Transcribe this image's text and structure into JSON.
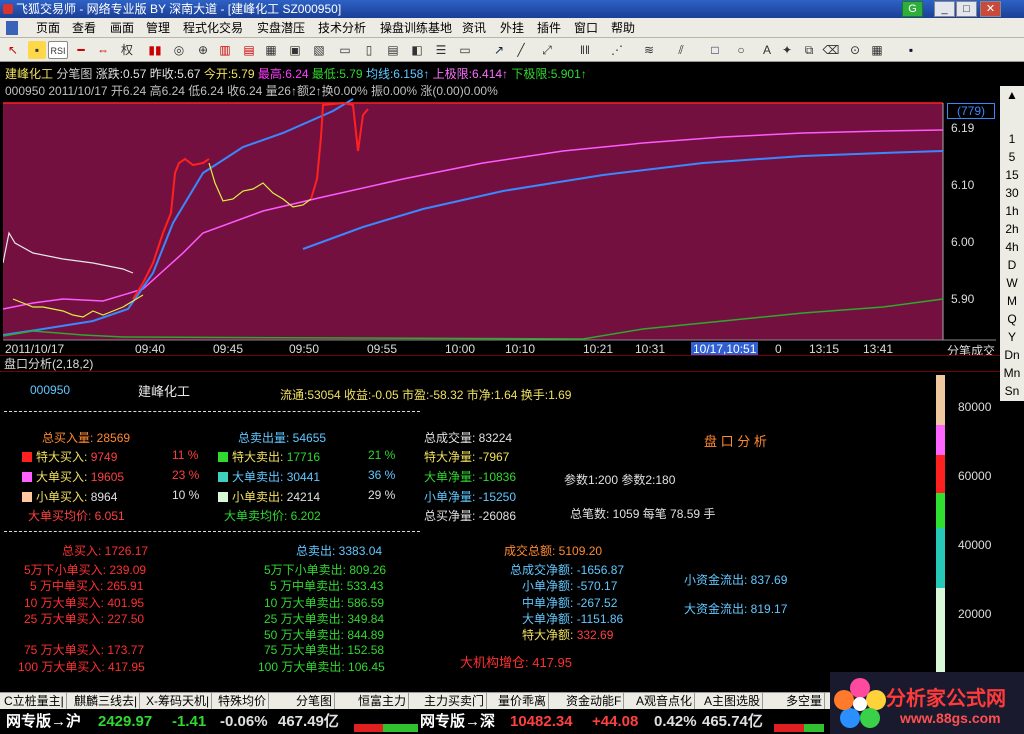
{
  "window": {
    "title": "飞狐交易师 - 网络专业版 BY 深南大道 - [建峰化工 SZ000950]",
    "min": "_",
    "max": "□",
    "close": "✕"
  },
  "menu": [
    "页面",
    "查看",
    "画面",
    "管理",
    "程式化交易",
    "实盘潜压",
    "技术分析",
    "操盘训练基地",
    "资讯",
    "外挂",
    "插件",
    "窗口",
    "帮助"
  ],
  "toolbar": {
    "rsi_label": "RSI",
    "quan_label": "权"
  },
  "chart": {
    "line1": {
      "name": "建峰化工",
      "type": "分笔图",
      "change": "涨跌:0.57",
      "prev": "昨收:5.67",
      "open": "今开:5.79",
      "high": "最高:6.24",
      "low": "最低:5.79",
      "avg": "均线:6.158↑",
      "uplimit": "上极限:6.414↑",
      "downlimit": "下极限:5.901↑"
    },
    "line2": "000950 2011/10/17 开6.24 高6.24 低6.24 收6.24 量26↑额2↑换0.00% 振0.00% 涨(0.00)0.00%",
    "price_box": "(779)",
    "y_labels": [
      "6.19",
      "6.10",
      "6.00",
      "5.90"
    ],
    "x_labels": [
      "2011/10/17",
      "09:40",
      "09:45",
      "09:50",
      "09:55",
      "10:00",
      "10:10",
      "10:21",
      "10:31",
      "10/17,10:51",
      "0",
      "13:15",
      "13:41"
    ],
    "corner_label": "分笔成交"
  },
  "sidebar": [
    "1",
    "5",
    "15",
    "30",
    "1h",
    "2h",
    "4h",
    "D",
    "W",
    "M",
    "Q",
    "Y",
    "Dn",
    "Mn",
    "Sn"
  ],
  "panel": {
    "title": "盘口分析(2,18,2)",
    "code": "000950",
    "name": "建峰化工",
    "stats": "流通:53054  收益:-0.05  市盈:-58.32  市净:1.64  换手:1.69",
    "buy_total": "总买入量: 28569",
    "buy_rows": [
      [
        "特大买入:",
        "9749",
        "11 %"
      ],
      [
        "大单买入:",
        "19605",
        "23 %"
      ],
      [
        "小单买入:",
        "8964",
        "10 %"
      ]
    ],
    "buy_avg": "大单买均价: 6.051",
    "sell_total": "总卖出量: 54655",
    "sell_rows": [
      [
        "特大卖出:",
        "17716",
        "21 %"
      ],
      [
        "大单卖出:",
        "30441",
        "36 %"
      ],
      [
        "小单卖出:",
        "24214",
        "29 %"
      ]
    ],
    "sell_avg": "大单卖均价: 6.202",
    "vol_rows": [
      "总成交量: 83224",
      "特大净量: -7967",
      "大单净量: -10836",
      "小单净量: -15250",
      "总买净量: -26086"
    ],
    "analysis_title": "盘 口 分 析",
    "params": "参数1:200  参数2:180",
    "total_trades": "总笔数: 1059  每笔  78.59 手",
    "total_buy": "总买入: 1726.17",
    "buy_amounts": [
      [
        "5万下小单买入:",
        "239.09"
      ],
      [
        "5 万中单买入:",
        "265.91"
      ],
      [
        "10 万大单买入:",
        "401.95"
      ],
      [
        "25 万大单买入:",
        "227.50"
      ],
      [
        "75 万大单买入:",
        "173.77"
      ],
      [
        "100 万大单买入:",
        "417.95"
      ]
    ],
    "total_sell": "总卖出: 3383.04",
    "sell_amounts": [
      [
        "5万下小单卖出:",
        "809.26"
      ],
      [
        "5 万中单卖出:",
        "533.43"
      ],
      [
        "10 万大单卖出:",
        "586.59"
      ],
      [
        "25 万大单卖出:",
        "349.84"
      ],
      [
        "50 万大单卖出:",
        "844.89"
      ],
      [
        "75 万大单卖出:",
        "152.58"
      ],
      [
        "100 万大单卖出:",
        "106.45"
      ]
    ],
    "turnover": "成交总额: 5109.20",
    "net_rows": [
      [
        "总成交净额:",
        "-1656.87"
      ],
      [
        "小单净额:",
        "-570.17"
      ],
      [
        "中单净额:",
        "-267.52"
      ],
      [
        "大单净额:",
        "-1151.86"
      ],
      [
        "特大净额:",
        "332.69"
      ]
    ],
    "small_out": "小资金流出: 837.69",
    "big_out": "大资金流出: 819.17",
    "inst": "大机构增仓: 417.95",
    "scale": [
      "80000",
      "60000",
      "40000",
      "20000"
    ]
  },
  "bottom_tabs": [
    "C立桩量主|",
    "麒麟三线去|",
    "X-筹码天机|",
    "特殊均价",
    "分笔图",
    "恒富主力",
    "主力买卖门",
    "量价乖离",
    "资金动能F",
    "A观音点化",
    "A主图选股",
    "多空量"
  ],
  "status": {
    "sh_label": "网专版→沪",
    "sh_index": "2429.97",
    "sh_chg": "-1.41",
    "sh_pct": "-0.06%",
    "sh_amt": "467.49亿",
    "sz_label": "网专版→深",
    "sz_index": "10482.34",
    "sz_chg": "+44.08",
    "sz_pct": "0.42%",
    "sz_amt": "465.74亿"
  },
  "ad": {
    "title": "分析家公式网",
    "url": "www.88gs.com"
  }
}
